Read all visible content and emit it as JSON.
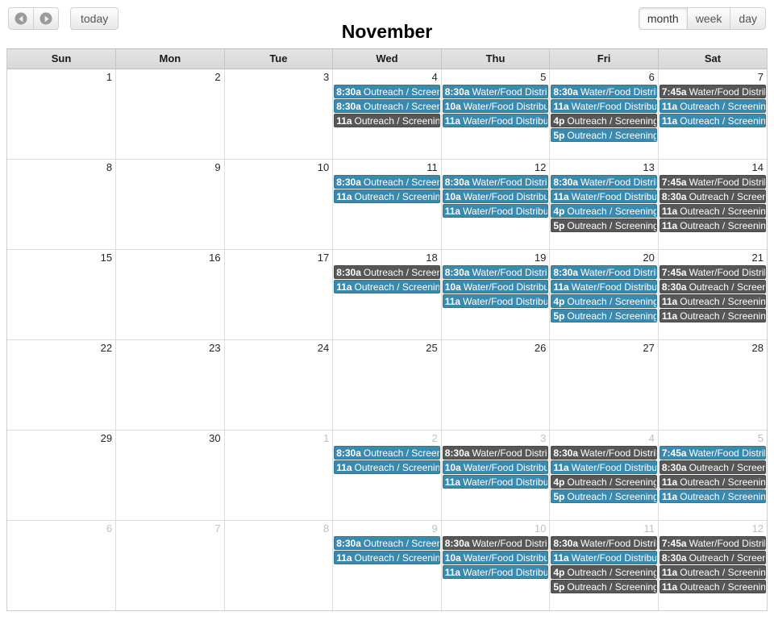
{
  "toolbar": {
    "prev_label": "",
    "next_label": "",
    "today_label": "today",
    "title": "November",
    "views": [
      {
        "key": "month",
        "label": "month",
        "active": true
      },
      {
        "key": "week",
        "label": "week",
        "active": false
      },
      {
        "key": "day",
        "label": "day",
        "active": false
      }
    ]
  },
  "colors": {
    "event_blue": "#3a8ab0",
    "event_gray": "#575757",
    "header_bg": "#dcdcdc",
    "grid_line": "#dddddd",
    "daynum": "#262626",
    "daynum_other": "#bfbfbf"
  },
  "grid": {
    "day_headers": [
      "Sun",
      "Mon",
      "Tue",
      "Wed",
      "Thu",
      "Fri",
      "Sat"
    ],
    "event_titles": {
      "outreach": "Outreach / Screening",
      "water": "Water/Food Distribution"
    },
    "weeks": [
      [
        {
          "num": "1",
          "other": false,
          "events": []
        },
        {
          "num": "2",
          "other": false,
          "events": []
        },
        {
          "num": "3",
          "other": false,
          "events": []
        },
        {
          "num": "4",
          "other": false,
          "events": [
            {
              "time": "8:30a",
              "title": "Outreach / Screening",
              "color": "blue"
            },
            {
              "time": "8:30a",
              "title": "Outreach / Screening",
              "color": "blue"
            },
            {
              "time": "11a",
              "title": "Outreach / Screening",
              "color": "gray"
            }
          ]
        },
        {
          "num": "5",
          "other": false,
          "events": [
            {
              "time": "8:30a",
              "title": "Water/Food Distribution",
              "color": "blue"
            },
            {
              "time": "10a",
              "title": "Water/Food Distribution",
              "color": "blue"
            },
            {
              "time": "11a",
              "title": "Water/Food Distribution",
              "color": "blue"
            }
          ]
        },
        {
          "num": "6",
          "other": false,
          "events": [
            {
              "time": "8:30a",
              "title": "Water/Food Distribution",
              "color": "blue"
            },
            {
              "time": "11a",
              "title": "Water/Food Distribution",
              "color": "blue"
            },
            {
              "time": "4p",
              "title": "Outreach / Screening",
              "color": "gray"
            },
            {
              "time": "5p",
              "title": "Outreach / Screening",
              "color": "blue"
            }
          ]
        },
        {
          "num": "7",
          "other": false,
          "events": [
            {
              "time": "7:45a",
              "title": "Water/Food Distribution",
              "color": "gray"
            },
            {
              "time": "11a",
              "title": "Outreach / Screening",
              "color": "blue"
            },
            {
              "time": "11a",
              "title": "Outreach / Screening",
              "color": "blue"
            }
          ]
        }
      ],
      [
        {
          "num": "8",
          "other": false,
          "events": []
        },
        {
          "num": "9",
          "other": false,
          "events": []
        },
        {
          "num": "10",
          "other": false,
          "events": []
        },
        {
          "num": "11",
          "other": false,
          "events": [
            {
              "time": "8:30a",
              "title": "Outreach / Screening",
              "color": "blue"
            },
            {
              "time": "11a",
              "title": "Outreach / Screening",
              "color": "blue"
            }
          ]
        },
        {
          "num": "12",
          "other": false,
          "events": [
            {
              "time": "8:30a",
              "title": "Water/Food Distribution",
              "color": "blue"
            },
            {
              "time": "10a",
              "title": "Water/Food Distribution",
              "color": "blue"
            },
            {
              "time": "11a",
              "title": "Water/Food Distribution",
              "color": "blue"
            }
          ]
        },
        {
          "num": "13",
          "other": false,
          "events": [
            {
              "time": "8:30a",
              "title": "Water/Food Distribution",
              "color": "blue"
            },
            {
              "time": "11a",
              "title": "Water/Food Distribution",
              "color": "blue"
            },
            {
              "time": "4p",
              "title": "Outreach / Screening",
              "color": "blue"
            },
            {
              "time": "5p",
              "title": "Outreach / Screening",
              "color": "gray"
            }
          ]
        },
        {
          "num": "14",
          "other": false,
          "events": [
            {
              "time": "7:45a",
              "title": "Water/Food Distribution",
              "color": "gray"
            },
            {
              "time": "8:30a",
              "title": "Outreach / Screening",
              "color": "gray"
            },
            {
              "time": "11a",
              "title": "Outreach / Screening",
              "color": "gray"
            },
            {
              "time": "11a",
              "title": "Outreach / Screening",
              "color": "gray"
            }
          ]
        }
      ],
      [
        {
          "num": "15",
          "other": false,
          "events": []
        },
        {
          "num": "16",
          "other": false,
          "events": []
        },
        {
          "num": "17",
          "other": false,
          "events": []
        },
        {
          "num": "18",
          "other": false,
          "events": [
            {
              "time": "8:30a",
              "title": "Outreach / Screening",
              "color": "gray"
            },
            {
              "time": "11a",
              "title": "Outreach / Screening",
              "color": "blue"
            }
          ]
        },
        {
          "num": "19",
          "other": false,
          "events": [
            {
              "time": "8:30a",
              "title": "Water/Food Distribution",
              "color": "blue"
            },
            {
              "time": "10a",
              "title": "Water/Food Distribution",
              "color": "blue"
            },
            {
              "time": "11a",
              "title": "Water/Food Distribution",
              "color": "blue"
            }
          ]
        },
        {
          "num": "20",
          "other": false,
          "events": [
            {
              "time": "8:30a",
              "title": "Water/Food Distribution",
              "color": "blue"
            },
            {
              "time": "11a",
              "title": "Water/Food Distribution",
              "color": "blue"
            },
            {
              "time": "4p",
              "title": "Outreach / Screening",
              "color": "blue"
            },
            {
              "time": "5p",
              "title": "Outreach / Screening",
              "color": "blue"
            }
          ]
        },
        {
          "num": "21",
          "other": false,
          "events": [
            {
              "time": "7:45a",
              "title": "Water/Food Distribution",
              "color": "gray"
            },
            {
              "time": "8:30a",
              "title": "Outreach / Screening",
              "color": "gray"
            },
            {
              "time": "11a",
              "title": "Outreach / Screening",
              "color": "gray"
            },
            {
              "time": "11a",
              "title": "Outreach / Screening",
              "color": "gray"
            }
          ]
        }
      ],
      [
        {
          "num": "22",
          "other": false,
          "events": []
        },
        {
          "num": "23",
          "other": false,
          "events": []
        },
        {
          "num": "24",
          "other": false,
          "events": []
        },
        {
          "num": "25",
          "other": false,
          "events": []
        },
        {
          "num": "26",
          "other": false,
          "events": []
        },
        {
          "num": "27",
          "other": false,
          "events": []
        },
        {
          "num": "28",
          "other": false,
          "events": []
        }
      ],
      [
        {
          "num": "29",
          "other": false,
          "events": []
        },
        {
          "num": "30",
          "other": false,
          "events": []
        },
        {
          "num": "1",
          "other": true,
          "events": []
        },
        {
          "num": "2",
          "other": true,
          "events": [
            {
              "time": "8:30a",
              "title": "Outreach / Screening",
              "color": "blue"
            },
            {
              "time": "11a",
              "title": "Outreach / Screening",
              "color": "blue"
            }
          ]
        },
        {
          "num": "3",
          "other": true,
          "events": [
            {
              "time": "8:30a",
              "title": "Water/Food Distribution",
              "color": "gray"
            },
            {
              "time": "10a",
              "title": "Water/Food Distribution",
              "color": "blue"
            },
            {
              "time": "11a",
              "title": "Water/Food Distribution",
              "color": "blue"
            }
          ]
        },
        {
          "num": "4",
          "other": true,
          "events": [
            {
              "time": "8:30a",
              "title": "Water/Food Distribution",
              "color": "gray"
            },
            {
              "time": "11a",
              "title": "Water/Food Distribution",
              "color": "blue"
            },
            {
              "time": "4p",
              "title": "Outreach / Screening",
              "color": "gray"
            },
            {
              "time": "5p",
              "title": "Outreach / Screening",
              "color": "blue"
            }
          ]
        },
        {
          "num": "5",
          "other": true,
          "events": [
            {
              "time": "7:45a",
              "title": "Water/Food Distribution",
              "color": "blue"
            },
            {
              "time": "8:30a",
              "title": "Outreach / Screening",
              "color": "gray"
            },
            {
              "time": "11a",
              "title": "Outreach / Screening",
              "color": "gray"
            },
            {
              "time": "11a",
              "title": "Outreach / Screening",
              "color": "blue"
            }
          ]
        }
      ],
      [
        {
          "num": "6",
          "other": true,
          "events": []
        },
        {
          "num": "7",
          "other": true,
          "events": []
        },
        {
          "num": "8",
          "other": true,
          "events": []
        },
        {
          "num": "9",
          "other": true,
          "events": [
            {
              "time": "8:30a",
              "title": "Outreach / Screening",
              "color": "blue"
            },
            {
              "time": "11a",
              "title": "Outreach / Screening",
              "color": "blue"
            }
          ]
        },
        {
          "num": "10",
          "other": true,
          "events": [
            {
              "time": "8:30a",
              "title": "Water/Food Distribution",
              "color": "gray"
            },
            {
              "time": "10a",
              "title": "Water/Food Distribution",
              "color": "blue"
            },
            {
              "time": "11a",
              "title": "Water/Food Distribution",
              "color": "blue"
            }
          ]
        },
        {
          "num": "11",
          "other": true,
          "events": [
            {
              "time": "8:30a",
              "title": "Water/Food Distribution",
              "color": "gray"
            },
            {
              "time": "11a",
              "title": "Water/Food Distribution",
              "color": "blue"
            },
            {
              "time": "4p",
              "title": "Outreach / Screening",
              "color": "gray"
            },
            {
              "time": "5p",
              "title": "Outreach / Screening",
              "color": "gray"
            }
          ]
        },
        {
          "num": "12",
          "other": true,
          "events": [
            {
              "time": "7:45a",
              "title": "Water/Food Distribution",
              "color": "gray"
            },
            {
              "time": "8:30a",
              "title": "Outreach / Screening",
              "color": "gray"
            },
            {
              "time": "11a",
              "title": "Outreach / Screening",
              "color": "gray"
            },
            {
              "time": "11a",
              "title": "Outreach / Screening",
              "color": "gray"
            }
          ]
        }
      ]
    ]
  }
}
